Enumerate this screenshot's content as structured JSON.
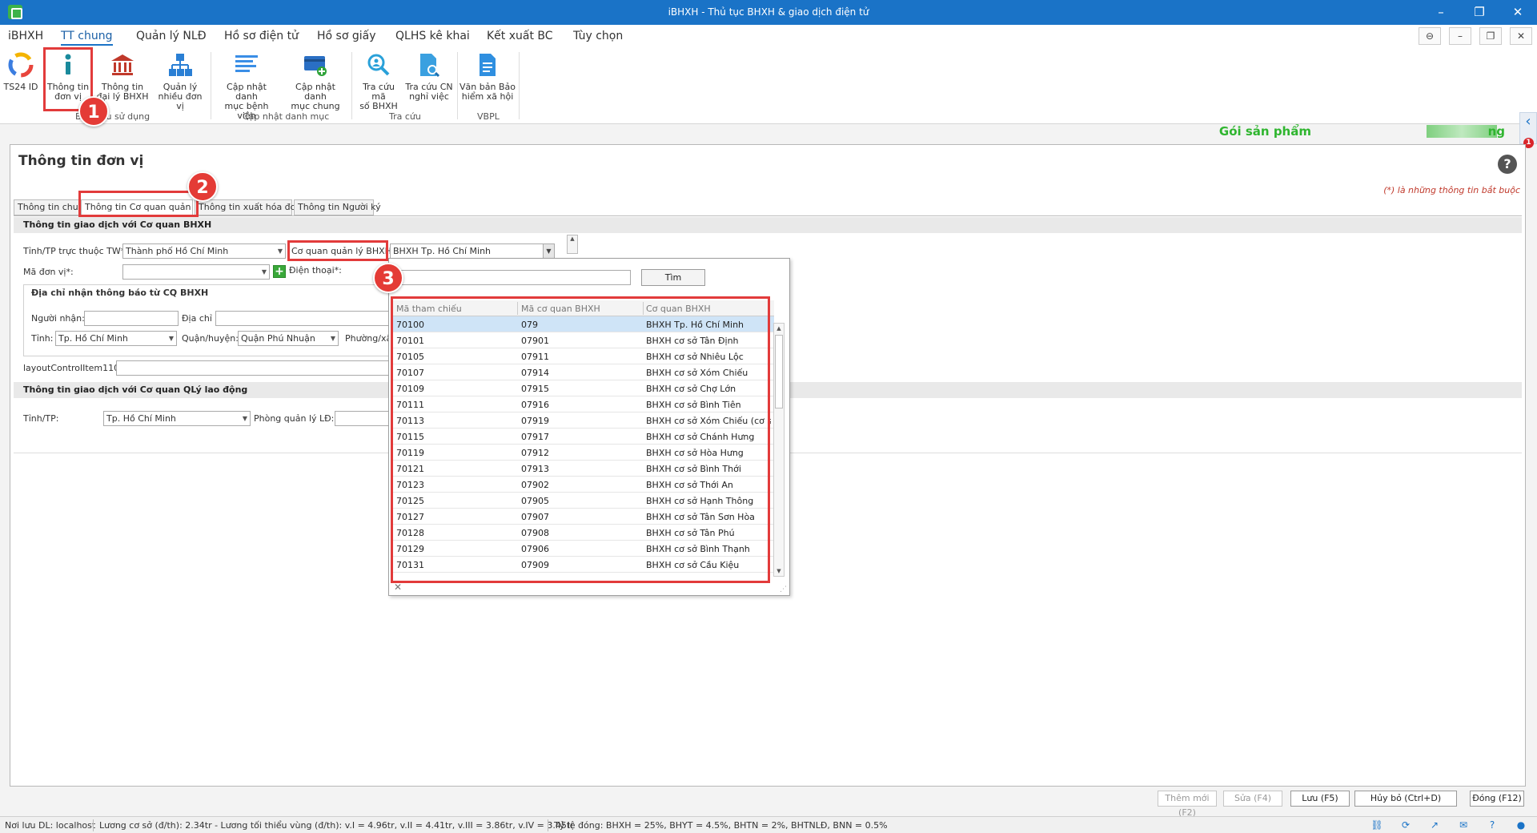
{
  "window": {
    "title": "iBHXH - Thủ tục BHXH & giao dịch điện tử",
    "min": "–",
    "restore": "❐",
    "close": "✕"
  },
  "menu": {
    "items": [
      "iBHXH",
      "TT chung",
      "Quản lý NLĐ",
      "Hồ sơ điện tử",
      "Hồ sơ giấy",
      "QLHS kê khai",
      "Kết xuất BC",
      "Tùy chọn"
    ],
    "active": "TT chung",
    "right_buttons": [
      "⊖",
      "–",
      "❐",
      "✕"
    ]
  },
  "ribbon": {
    "buttons": [
      {
        "line1": "TS24 ID",
        "line2": "",
        "icon": "ts24-logo-icon"
      },
      {
        "line1": "Thông tin",
        "line2": "đơn vị",
        "icon": "info-icon"
      },
      {
        "line1": "Thông tin",
        "line2": "đại lý BHXH",
        "icon": "bank-icon"
      },
      {
        "line1": "Quản lý",
        "line2": "nhiều đơn vị",
        "icon": "org-chart-icon"
      },
      {
        "line1": "Cập nhật danh",
        "line2": "mục bệnh viện",
        "icon": "list-update-icon"
      },
      {
        "line1": "Cập nhật danh",
        "line2": "mục chung",
        "icon": "card-add-icon"
      },
      {
        "line1": "Tra cứu mã",
        "line2": "số BHXH",
        "icon": "search-people-icon"
      },
      {
        "line1": "Tra cứu CN",
        "line2": "nghỉ việc",
        "icon": "search-doc-icon"
      },
      {
        "line1": "Văn bản Bảo",
        "line2": "hiểm xã hội",
        "icon": "document-icon"
      }
    ],
    "groups": [
      "Ban đầu sử dụng",
      "Cập nhật danh mục",
      "Tra cứu",
      "VBPL"
    ]
  },
  "banner": {
    "text_left": "Gói sản phẩm",
    "text_right": "ng"
  },
  "side_badge": "1",
  "panel": {
    "title": "Thông tin đơn vị",
    "help": "?",
    "required_note": "(*) là những thông tin bắt buộc",
    "tabs": [
      "Thông tin chung",
      "Thông tin Cơ quan quản lý",
      "Thông tin xuất hóa đơn",
      "Thông tin Người ký"
    ]
  },
  "section1": {
    "header": "Thông tin giao dịch với Cơ quan BHXH",
    "province_label": "Tỉnh/TP trực thuộc TW*:",
    "province_value": "Thành phố Hồ Chí Minh",
    "agency_label": "Cơ quan quản lý BHXH*:",
    "agency_value": "BHXH Tp. Hồ Chí Minh",
    "unit_code_label": "Mã đơn vị*:",
    "unit_code_value": "",
    "phone_label": "Điện thoại*:",
    "address_box": {
      "header": "Địa chỉ nhận thông báo từ CQ BHXH",
      "recipient_label": "Người nhận:",
      "address_label": "Địa chỉ",
      "province_label": "Tỉnh:",
      "province_value": "Tp. Hồ Chí Minh",
      "district_label": "Quận/huyện:",
      "district_value": "Quận Phú Nhuận",
      "ward_label": "Phường/xã"
    },
    "layout_label": "layoutControlItem110"
  },
  "section2": {
    "header": "Thông tin giao dịch với Cơ quan QLý lao động",
    "province_label": "Tỉnh/TP:",
    "province_value": "Tp. Hồ Chí Minh",
    "office_label": "Phòng quản lý LĐ:"
  },
  "popup": {
    "find_label": "Tìm",
    "columns": [
      "Mã tham chiếu",
      "Mã cơ quan BHXH",
      "Cơ quan BHXH"
    ],
    "rows": [
      [
        "70100",
        "079",
        "BHXH Tp. Hồ Chí Minh"
      ],
      [
        "70101",
        "07901",
        "BHXH cơ sở Tân Định"
      ],
      [
        "70105",
        "07911",
        "BHXH cơ sở Nhiêu Lộc"
      ],
      [
        "70107",
        "07914",
        "BHXH cơ sở Xóm Chiếu"
      ],
      [
        "70109",
        "07915",
        "BHXH cơ sở Chợ Lớn"
      ],
      [
        "70111",
        "07916",
        "BHXH cơ sở Bình Tiên"
      ],
      [
        "70113",
        "07919",
        "BHXH cơ sở Xóm Chiếu (cơ sở ..."
      ],
      [
        "70115",
        "07917",
        "BHXH cơ sở Chánh Hưng"
      ],
      [
        "70119",
        "07912",
        "BHXH cơ sở Hòa Hưng"
      ],
      [
        "70121",
        "07913",
        "BHXH cơ sở Bình Thới"
      ],
      [
        "70123",
        "07902",
        "BHXH cơ sở Thới An"
      ],
      [
        "70125",
        "07905",
        "BHXH cơ sở Hạnh Thông"
      ],
      [
        "70127",
        "07907",
        "BHXH cơ sở Tân Sơn Hòa"
      ],
      [
        "70128",
        "07908",
        "BHXH cơ sở Tân Phú"
      ],
      [
        "70129",
        "07906",
        "BHXH cơ sở Bình Thạnh"
      ],
      [
        "70131",
        "07909",
        "BHXH cơ sở Cầu Kiệu"
      ]
    ],
    "close": "✕"
  },
  "callouts": [
    "1",
    "2",
    "3"
  ],
  "bottom_buttons": [
    "Thêm mới (F2)",
    "Sửa (F4)",
    "Lưu (F5)",
    "Hủy bỏ (Ctrl+D)",
    "Đóng (F12)"
  ],
  "status": {
    "db": "Nơi lưu DL: localhost",
    "salary": "Lương cơ sở (đ/th): 2.34tr - Lương tối thiểu vùng (đ/th): v.I = 4.96tr, v.II = 4.41tr, v.III = 3.86tr, v.IV = 3.45tr",
    "rates": "Tỷ lệ đóng: BHXH = 25%, BHYT = 4.5%, BHTN = 2%, BHTNLĐ, BNN = 0.5%"
  },
  "colors": {
    "titlebar": "#1a73c7",
    "highlight": "#e23b3b",
    "banner_green": "#2fb52f",
    "selected_row": "#cfe4f7"
  }
}
